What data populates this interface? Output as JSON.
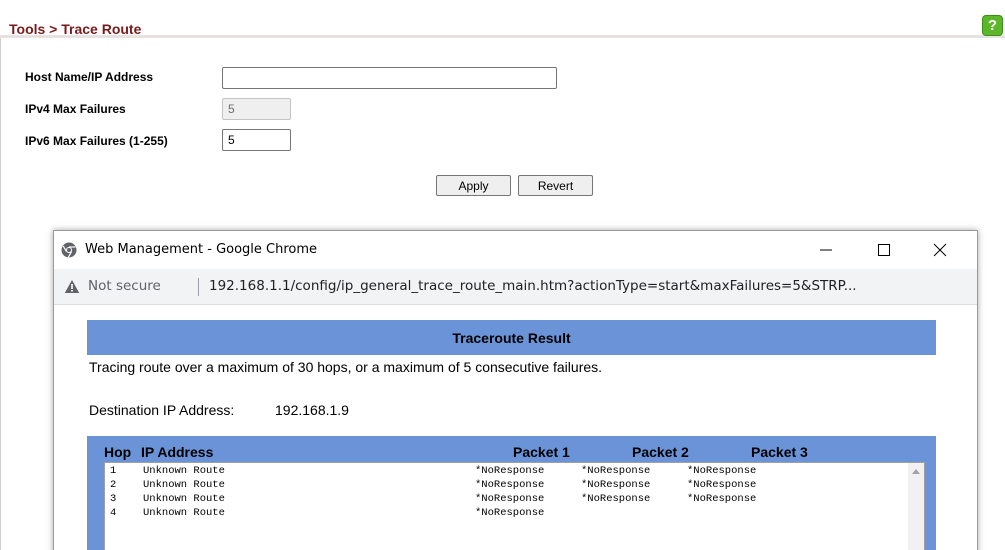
{
  "header": {
    "breadcrumb": "Tools > Trace Route",
    "help_icon": "question-mark-icon",
    "help_label": "?"
  },
  "form": {
    "host_label": "Host Name/IP Address",
    "host_value": "",
    "ipv4_label": "IPv4 Max Failures",
    "ipv4_value": "5",
    "ipv6_label": "IPv6 Max Failures (1-255)",
    "ipv6_value": "5",
    "apply_label": "Apply",
    "revert_label": "Revert"
  },
  "popup": {
    "title": "Web Management - Google Chrome",
    "not_secure": "Not secure",
    "url": "192.168.1.1/config/ip_general_trace_route_main.htm?actionType=start&maxFailures=5&STRP...",
    "result_title": "Traceroute Result",
    "trace_info": "Tracing route over a maximum of 30 hops, or a maximum of 5 consecutive failures.",
    "dest_label": "Destination IP Address:",
    "dest_value": "192.168.1.9",
    "columns": {
      "hop": "Hop",
      "ip": "IP Address",
      "packet1": "Packet 1",
      "packet2": "Packet 2",
      "packet3": "Packet 3"
    },
    "rows": [
      {
        "hop": "1",
        "ip": "Unknown Route",
        "p1": "*NoResponse",
        "p2": "*NoResponse",
        "p3": "*NoResponse"
      },
      {
        "hop": "2",
        "ip": "Unknown Route",
        "p1": "*NoResponse",
        "p2": "*NoResponse",
        "p3": "*NoResponse"
      },
      {
        "hop": "3",
        "ip": "Unknown Route",
        "p1": "*NoResponse",
        "p2": "*NoResponse",
        "p3": "*NoResponse"
      },
      {
        "hop": "4",
        "ip": "Unknown Route",
        "p1": "*NoResponse",
        "p2": "",
        "p3": ""
      }
    ]
  },
  "colors": {
    "breadcrumb": "#7a1a1a",
    "help_green": "#5cb82a",
    "result_blue": "#6a93d8"
  }
}
